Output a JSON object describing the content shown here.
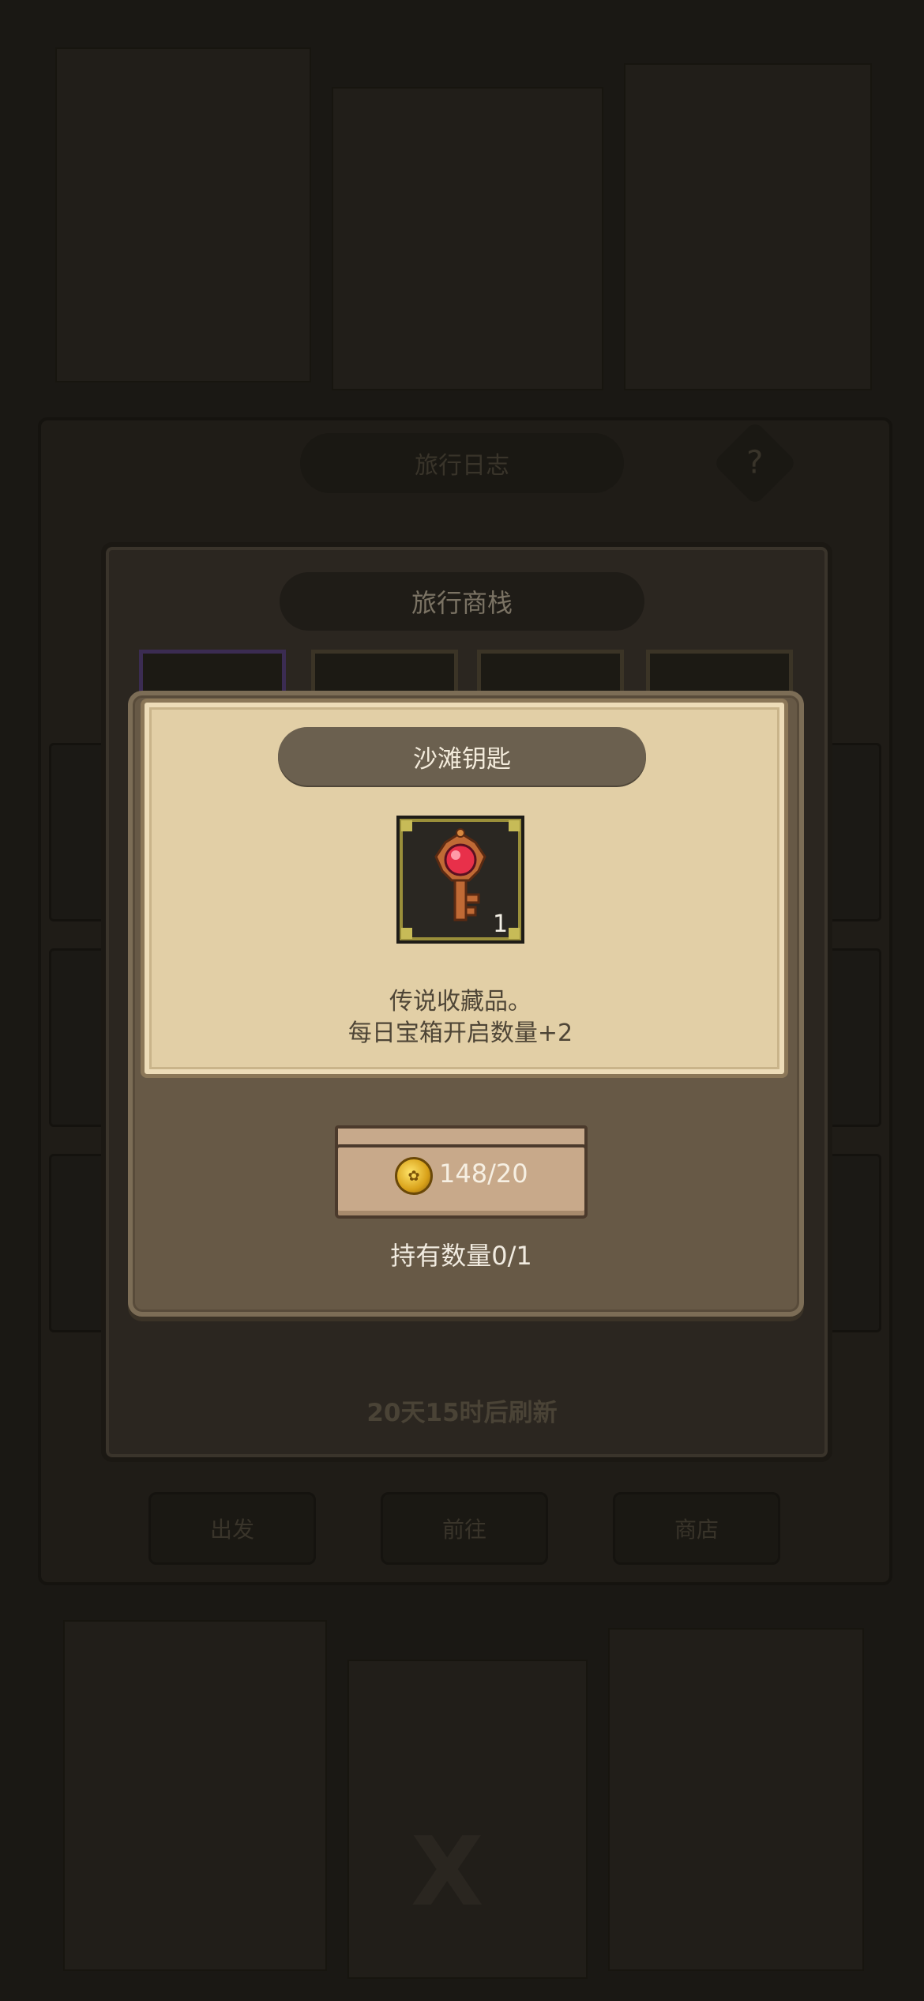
{
  "background": {
    "window_title": "旅行日志",
    "help_icon": "?",
    "tabs": [
      "出发",
      "前往",
      "商店"
    ]
  },
  "shop": {
    "title": "旅行商栈",
    "refresh_text": "20天15时后刷新"
  },
  "popup": {
    "item_name": "沙滩钥匙",
    "item_icon": "key-icon",
    "item_count": "1",
    "desc_line1": "传说收藏品。",
    "desc_line2": "每日宝箱开启数量+2",
    "price_text": "148/20",
    "currency_icon": "coin-icon",
    "owned_text": "持有数量0/1"
  },
  "colors": {
    "parchment": "#e2cfa6",
    "popup_frame": "#675946",
    "title_pill": "#6b604f",
    "price_board": "#c8a98a",
    "gem": "#e8304a"
  }
}
